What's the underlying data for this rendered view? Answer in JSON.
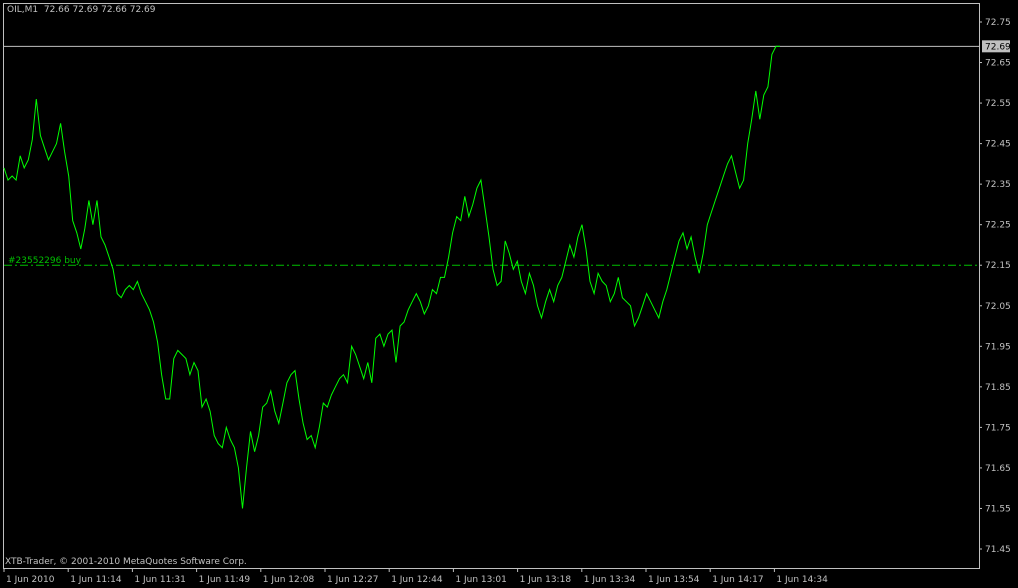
{
  "header": {
    "symbol": "OIL,M1",
    "ohlc": "72.66 72.69 72.66 72.69"
  },
  "copyright": "XTB-Trader, © 2001-2010 MetaQuotes Software Corp.",
  "order": {
    "label": "#23552296 buy",
    "price": 72.15
  },
  "current_price": {
    "label": "72.69",
    "value": 72.69
  },
  "colors": {
    "background": "#000000",
    "line": "#00ff00",
    "axes": "#c0c0c0",
    "order_line": "#00c000"
  },
  "chart_data": {
    "type": "line",
    "title": "",
    "xlabel": "",
    "ylabel": "",
    "ylim": [
      71.42,
      72.8
    ],
    "grid": false,
    "y_ticks": [
      "72.75",
      "72.65",
      "72.55",
      "72.45",
      "72.35",
      "72.25",
      "72.15",
      "72.05",
      "71.95",
      "71.85",
      "71.75",
      "71.65",
      "71.55",
      "71.45"
    ],
    "x_ticks": [
      "1 Jun 2010",
      "1 Jun 11:14",
      "1 Jun 11:31",
      "1 Jun 11:49",
      "1 Jun 12:08",
      "1 Jun 12:27",
      "1 Jun 12:44",
      "1 Jun 13:01",
      "1 Jun 13:18",
      "1 Jun 13:34",
      "1 Jun 13:54",
      "1 Jun 14:17",
      "1 Jun 14:34"
    ],
    "series": [
      {
        "values": [
          72.39,
          72.36,
          72.37,
          72.36,
          72.42,
          72.39,
          72.41,
          72.46,
          72.56,
          72.47,
          72.44,
          72.41,
          72.43,
          72.45,
          72.5,
          72.43,
          72.37,
          72.26,
          72.23,
          72.19,
          72.24,
          72.31,
          72.25,
          72.31,
          72.22,
          72.2,
          72.17,
          72.14,
          72.08,
          72.07,
          72.09,
          72.1,
          72.09,
          72.11,
          72.08,
          72.06,
          72.04,
          72.01,
          71.96,
          71.88,
          71.82,
          71.82,
          71.92,
          71.94,
          71.93,
          71.92,
          71.88,
          71.91,
          71.89,
          71.8,
          71.82,
          71.79,
          71.73,
          71.71,
          71.7,
          71.75,
          71.72,
          71.7,
          71.65,
          71.55,
          71.65,
          71.74,
          71.69,
          71.73,
          71.8,
          71.81,
          71.84,
          71.79,
          71.76,
          71.81,
          71.86,
          71.88,
          71.89,
          71.82,
          71.76,
          71.72,
          71.73,
          71.7,
          71.75,
          71.81,
          71.8,
          71.83,
          71.85,
          71.87,
          71.88,
          71.86,
          71.95,
          71.93,
          71.9,
          71.87,
          71.91,
          71.86,
          71.97,
          71.98,
          71.95,
          71.98,
          71.99,
          71.91,
          72.0,
          72.01,
          72.04,
          72.06,
          72.08,
          72.06,
          72.03,
          72.05,
          72.09,
          72.08,
          72.12,
          72.12,
          72.17,
          72.23,
          72.27,
          72.26,
          72.32,
          72.27,
          72.3,
          72.34,
          72.36,
          72.29,
          72.22,
          72.14,
          72.1,
          72.11,
          72.21,
          72.18,
          72.14,
          72.16,
          72.11,
          72.08,
          72.13,
          72.1,
          72.05,
          72.02,
          72.06,
          72.09,
          72.06,
          72.1,
          72.12,
          72.16,
          72.2,
          72.17,
          72.22,
          72.25,
          72.19,
          72.11,
          72.08,
          72.13,
          72.11,
          72.1,
          72.06,
          72.08,
          72.12,
          72.07,
          72.06,
          72.05,
          72.0,
          72.02,
          72.05,
          72.08,
          72.06,
          72.04,
          72.02,
          72.06,
          72.09,
          72.13,
          72.17,
          72.21,
          72.23,
          72.19,
          72.22,
          72.17,
          72.13,
          72.18,
          72.25,
          72.28,
          72.31,
          72.34,
          72.37,
          72.4,
          72.42,
          72.38,
          72.34,
          72.36,
          72.45,
          72.51,
          72.58,
          72.51,
          72.57,
          72.59,
          72.67,
          72.69,
          72.69
        ]
      }
    ]
  }
}
